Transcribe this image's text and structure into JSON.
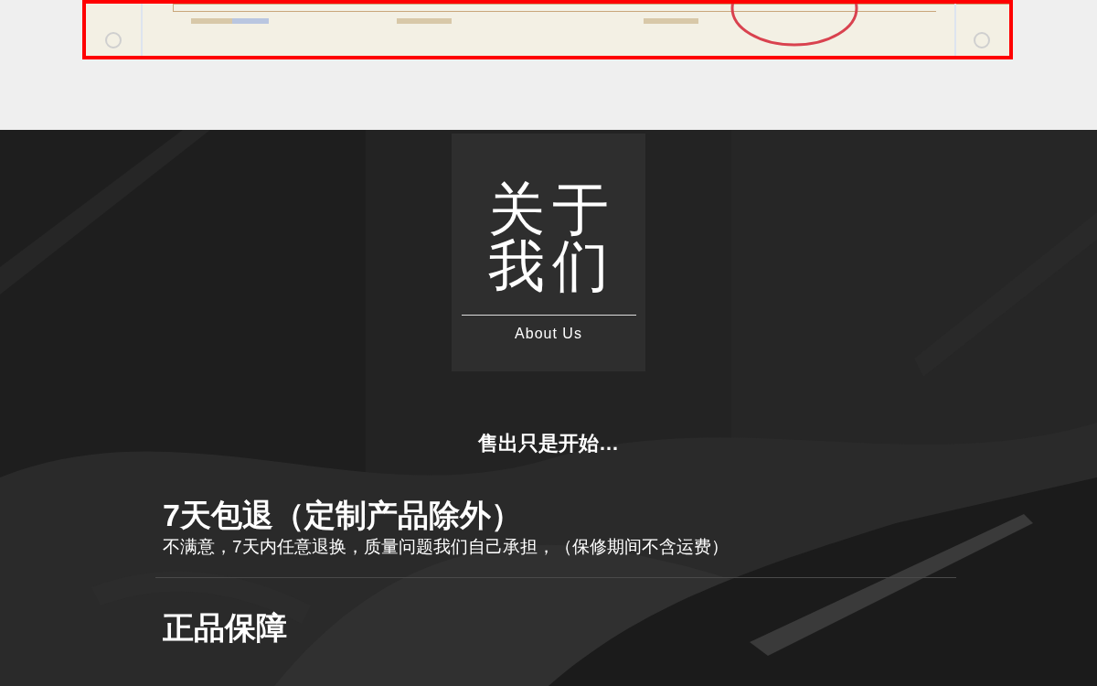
{
  "about": {
    "title": "关于我们",
    "subtitle": "About Us"
  },
  "tagline": "售出只是开始…",
  "guarantees": [
    {
      "title": "7天包退（定制产品除外）",
      "description": "不满意，7天内任意退换，质量问题我们自己承担，（保修期间不含运费）"
    },
    {
      "title": "正品保障"
    }
  ]
}
